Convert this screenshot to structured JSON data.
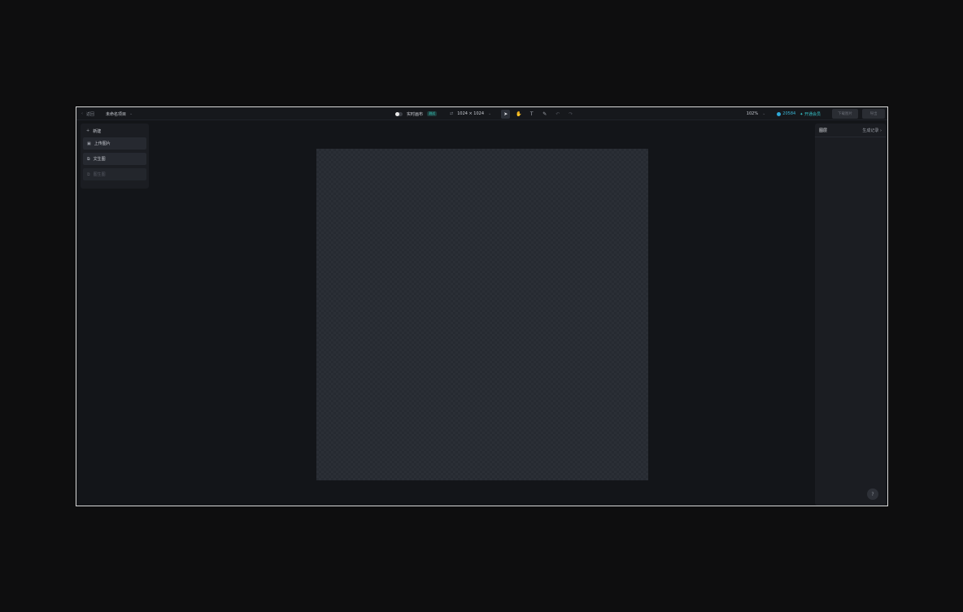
{
  "topbar": {
    "back_label": "返回",
    "project_title": "未命名项目",
    "realtime_label": "实时画布",
    "realtime_tag": "测试",
    "canvas_size": "1024 × 1024",
    "zoom_level": "102%",
    "credits": "20584",
    "member_label": "开通会员",
    "btn_primary_label": "下载图片",
    "btn_secondary_label": "导出"
  },
  "left_panel": {
    "new_label": "新建",
    "items": [
      {
        "label": "上传图片",
        "icon": "image-upload-icon",
        "enabled": true
      },
      {
        "label": "文生图",
        "icon": "text-to-image-icon",
        "enabled": true
      },
      {
        "label": "图生图",
        "icon": "image-to-image-icon",
        "enabled": false
      }
    ]
  },
  "right_panel": {
    "title": "图层",
    "history_label": "生成记录"
  },
  "help_label": "?",
  "colors": {
    "accent": "#39d3c5",
    "credits": "#2fa9d8",
    "background": "#131519",
    "panel": "#1b1d22"
  }
}
